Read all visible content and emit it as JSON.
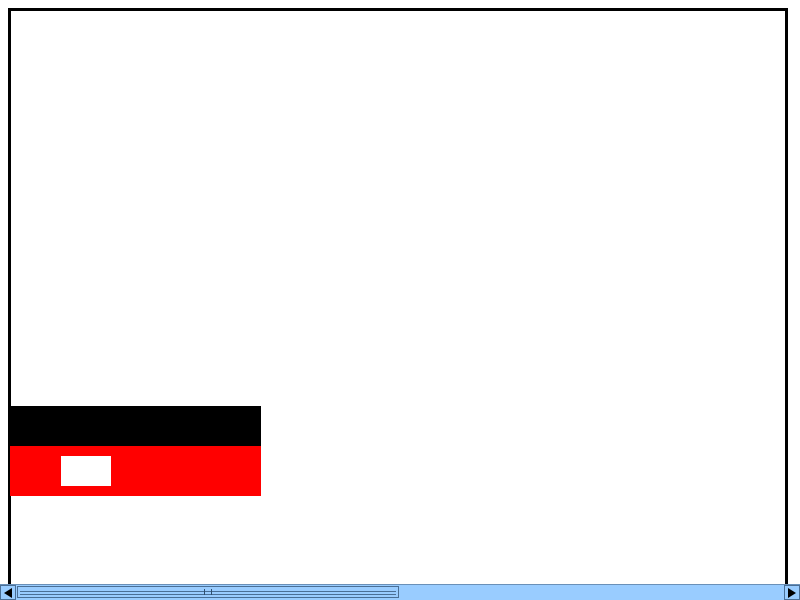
{
  "window": {
    "title": ""
  },
  "colors": {
    "background": "#ffffff",
    "border": "#000000",
    "flag_red": "#ff0000",
    "flag_black": "#000000",
    "flag_white": "#ffffff",
    "scrollbar": "#99ccff"
  },
  "scrollbar": {
    "orientation": "horizontal",
    "left_arrow_icon": "arrow-left-icon",
    "right_arrow_icon": "arrow-right-icon",
    "thumb_fraction": 0.5,
    "position_fraction": 0.0
  }
}
